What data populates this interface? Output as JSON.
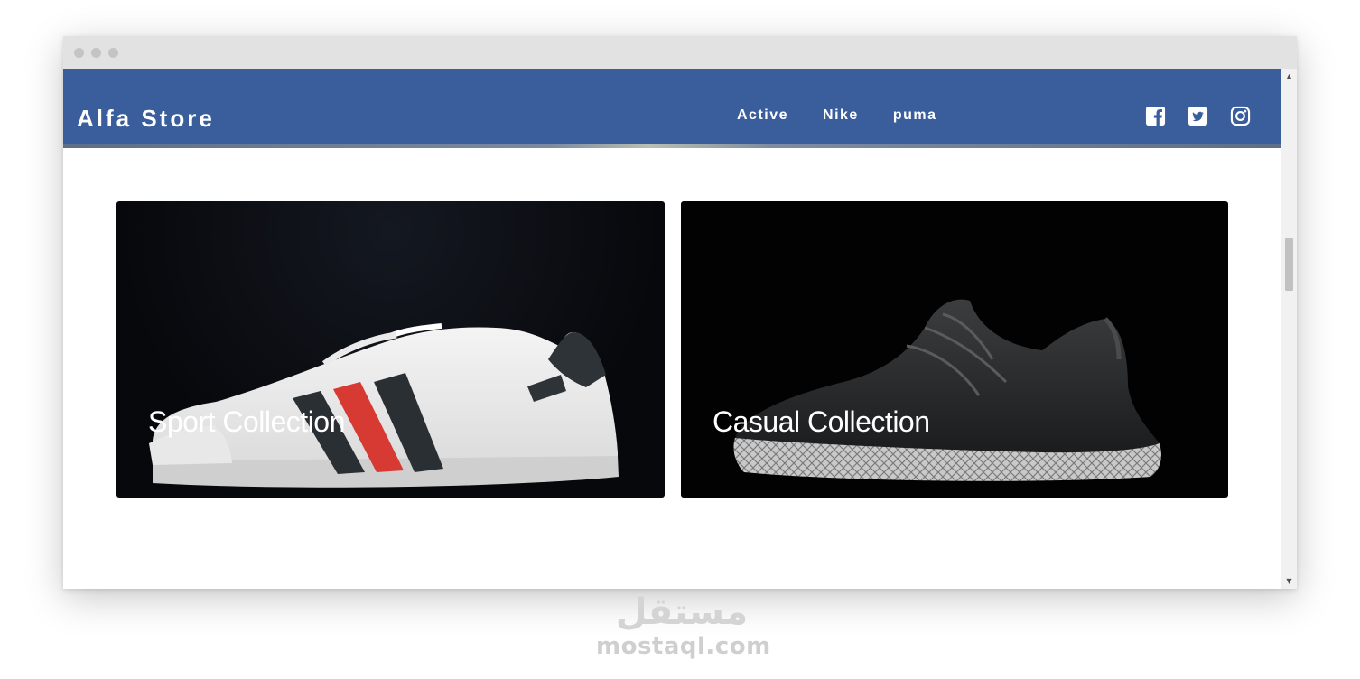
{
  "navbar": {
    "brand": "Alfa Store",
    "links": [
      {
        "label": "Active"
      },
      {
        "label": "Nike"
      },
      {
        "label": "puma"
      }
    ],
    "socials": [
      {
        "icon": "facebook-icon"
      },
      {
        "icon": "twitter-icon"
      },
      {
        "icon": "instagram-icon"
      }
    ],
    "color": "#3a5e9c"
  },
  "cards": [
    {
      "title": "Sport Collection"
    },
    {
      "title": "Casual Collection"
    }
  ],
  "watermark": {
    "arabic": "مستقل",
    "text": "mostaql.com"
  }
}
